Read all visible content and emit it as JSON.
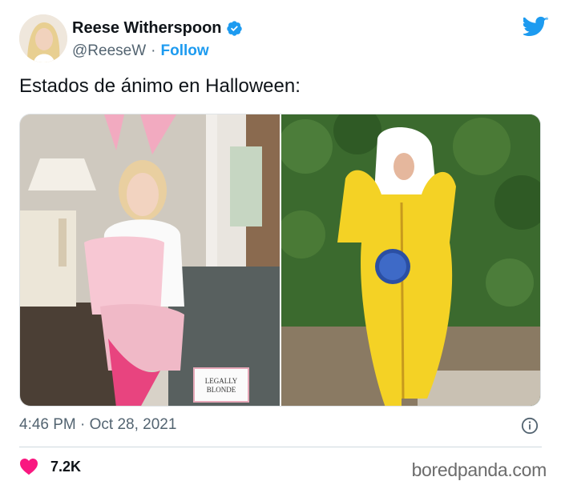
{
  "user": {
    "display_name": "Reese Witherspoon",
    "handle": "@ReeseW",
    "separator": "·",
    "follow_label": "Follow"
  },
  "tweet": {
    "text": "Estados de ánimo en Halloween:",
    "time": "4:46 PM · Oct 28, 2021",
    "likes": "7.2K"
  },
  "media": {
    "left_photo_sign": "LEGALLY BLONDE"
  },
  "watermark": "boredpanda.com",
  "colors": {
    "accent": "#1d9bf0",
    "like": "#f91880",
    "muted": "#536471",
    "text": "#0f1419"
  },
  "icons": {
    "verified": "verified-badge-icon",
    "brand": "twitter-bird-icon",
    "info": "info-icon",
    "like": "heart-icon"
  }
}
